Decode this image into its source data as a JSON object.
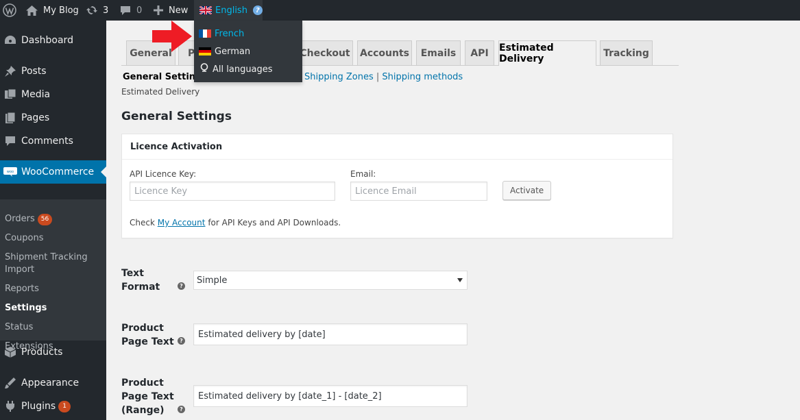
{
  "adminbar": {
    "site_name": "My Blog",
    "updates_count": "3",
    "comments_count": "0",
    "new_label": "New",
    "language_label": "English"
  },
  "language_menu": {
    "items": [
      {
        "label": "French",
        "flag": "flag-fr"
      },
      {
        "label": "German",
        "flag": "flag-de"
      },
      {
        "label": "All languages",
        "icon": "globe-icon"
      }
    ]
  },
  "sidebar": {
    "items": [
      {
        "label": "Dashboard",
        "icon": "dashboard-icon"
      },
      {
        "label": "Posts",
        "icon": "pin-icon"
      },
      {
        "label": "Media",
        "icon": "media-icon"
      },
      {
        "label": "Pages",
        "icon": "pages-icon"
      },
      {
        "label": "Comments",
        "icon": "comments-icon"
      },
      {
        "label": "WooCommerce",
        "icon": "woocommerce-icon"
      },
      {
        "label": "Products",
        "icon": "products-icon"
      },
      {
        "label": "Appearance",
        "icon": "appearance-icon"
      },
      {
        "label": "Plugins",
        "icon": "plugins-icon",
        "badge": "1"
      }
    ],
    "submenu": [
      {
        "label": "Orders",
        "badge": "56"
      },
      {
        "label": "Coupons"
      },
      {
        "label": "Shipment Tracking Import"
      },
      {
        "label": "Reports"
      },
      {
        "label": "Settings"
      },
      {
        "label": "Status"
      },
      {
        "label": "Extensions"
      }
    ],
    "colors": {
      "bg": "#23282d",
      "current": "#0073aa",
      "badge": "#ca4a1f"
    }
  },
  "tabs": {
    "items": [
      "General",
      "P",
      "Checkout",
      "Accounts",
      "Emails",
      "API",
      "Estimated Delivery",
      "Tracking"
    ],
    "active": "Estimated Delivery"
  },
  "subnav": {
    "current": "General Settings",
    "links": [
      "Shipping Zones",
      "Shipping methods"
    ],
    "sep": "|",
    "breadcrumb": "Estimated Delivery"
  },
  "main": {
    "heading": "General Settings",
    "licence": {
      "title": "Licence Activation",
      "key_label": "API Licence Key:",
      "key_placeholder": "Licence Key",
      "email_label": "Email:",
      "email_placeholder": "Licence Email",
      "activate_label": "Activate",
      "note_prefix": "Check",
      "note_link": "My Account",
      "note_suffix": "for API Keys and API Downloads."
    },
    "fields": [
      {
        "label": "Text Format",
        "value": "Simple",
        "type": "select"
      },
      {
        "label": "Product Page Text",
        "value": "Estimated delivery by [date]",
        "type": "text"
      },
      {
        "label": "Product Page Text (Range)",
        "value": "Estimated delivery by [date_1] - [date_2]",
        "type": "text"
      }
    ]
  }
}
